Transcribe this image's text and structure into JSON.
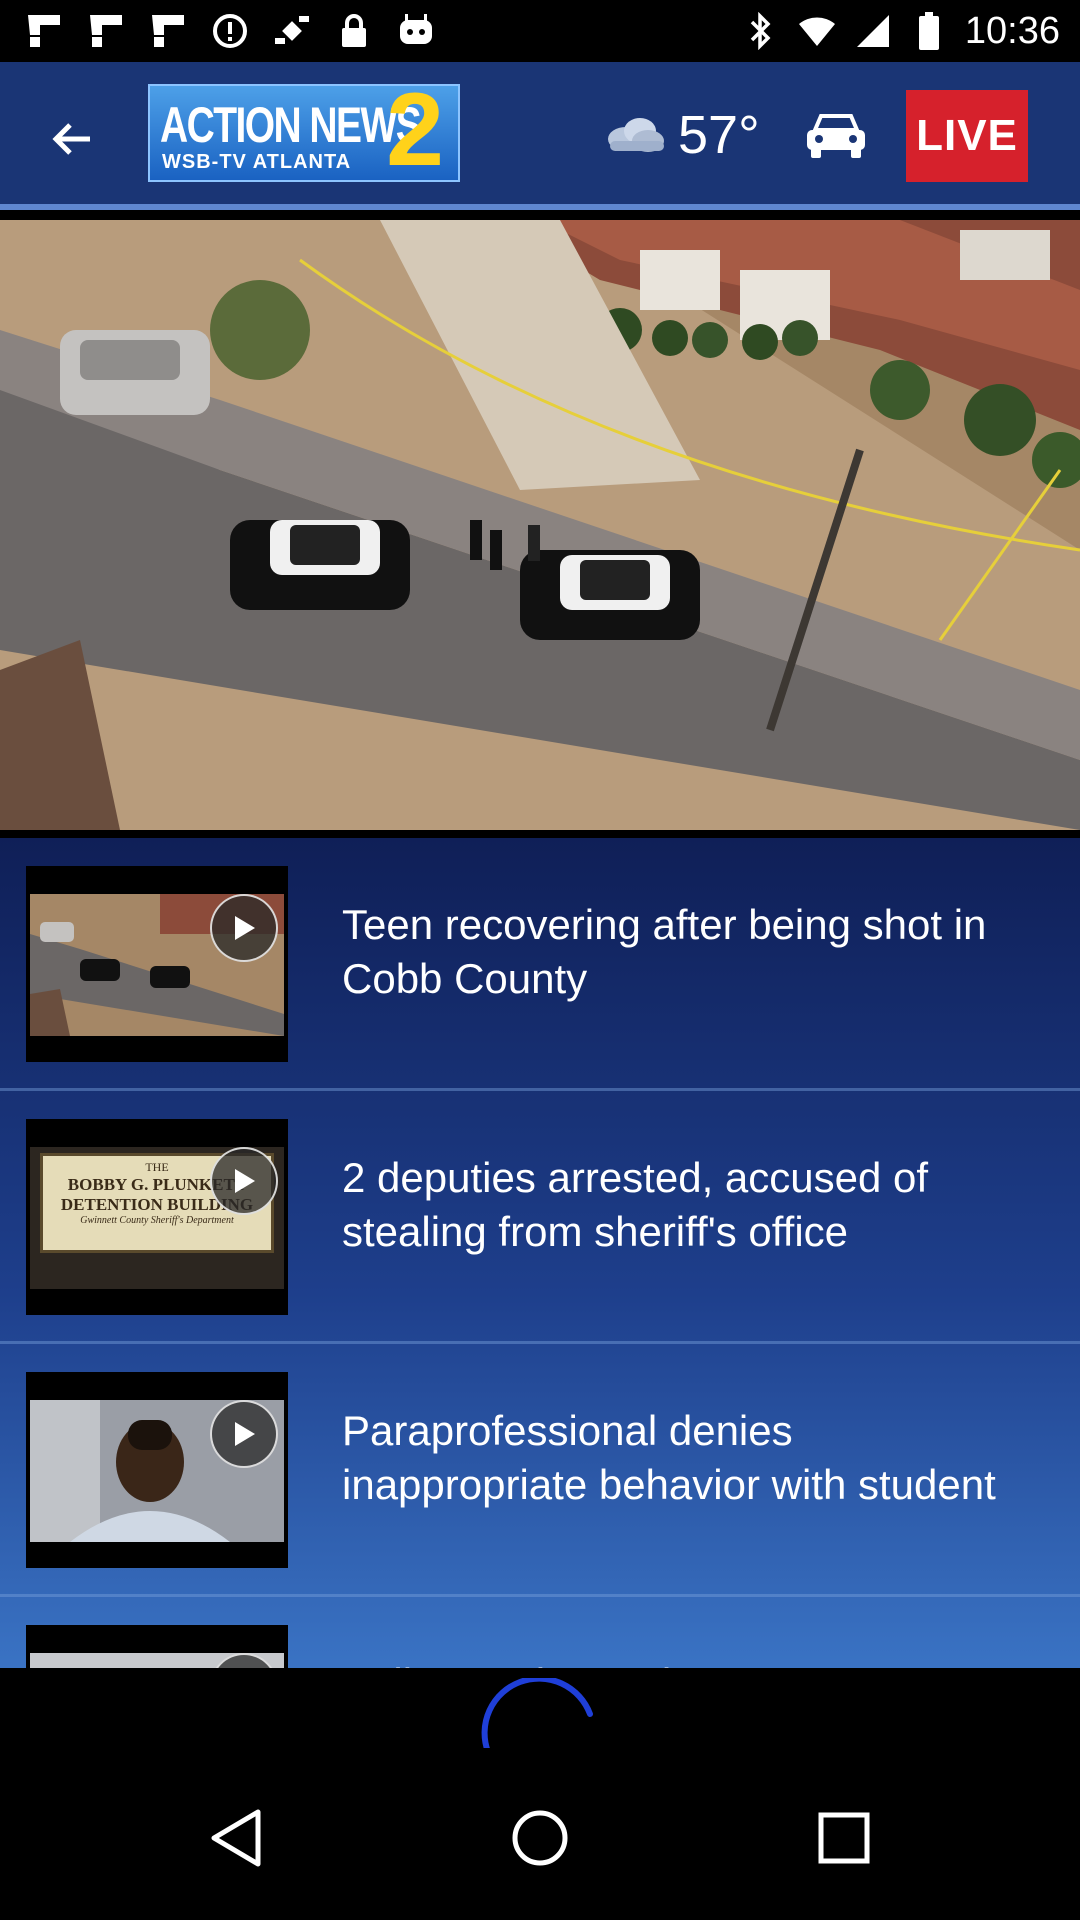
{
  "status_bar": {
    "time": "10:36",
    "left_icons": [
      "flipboard-icon",
      "flipboard-icon",
      "flipboard-icon",
      "alert-icon",
      "fake-gps-icon",
      "lock-icon",
      "android-icon"
    ],
    "right_icons": [
      "bluetooth-icon",
      "wifi-icon",
      "signal-icon",
      "battery-icon"
    ]
  },
  "header": {
    "logo_main": "ACTION NEWS",
    "logo_number": "2",
    "logo_sub": "WSB-TV ATLANTA",
    "temperature": "57°",
    "live_label": "LIVE",
    "colors": {
      "bar": "#1a3575",
      "live": "#d6212c",
      "logo_number": "#ffd21a"
    }
  },
  "stories": [
    {
      "title": "Teen recovering after being shot in Cobb County"
    },
    {
      "title": "2 deputies arrested, accused of stealing from sheriff's office"
    },
    {
      "title": "Paraprofessional denies inappropriate behavior with student"
    },
    {
      "title": "Police seek people"
    }
  ],
  "thumb_text": {
    "sign_line1": "THE",
    "sign_line2": "BOBBY G. PLUNKETT",
    "sign_line3": "DETENTION BUILDING",
    "sign_line4": "Gwinnett County Sheriff's Department"
  }
}
